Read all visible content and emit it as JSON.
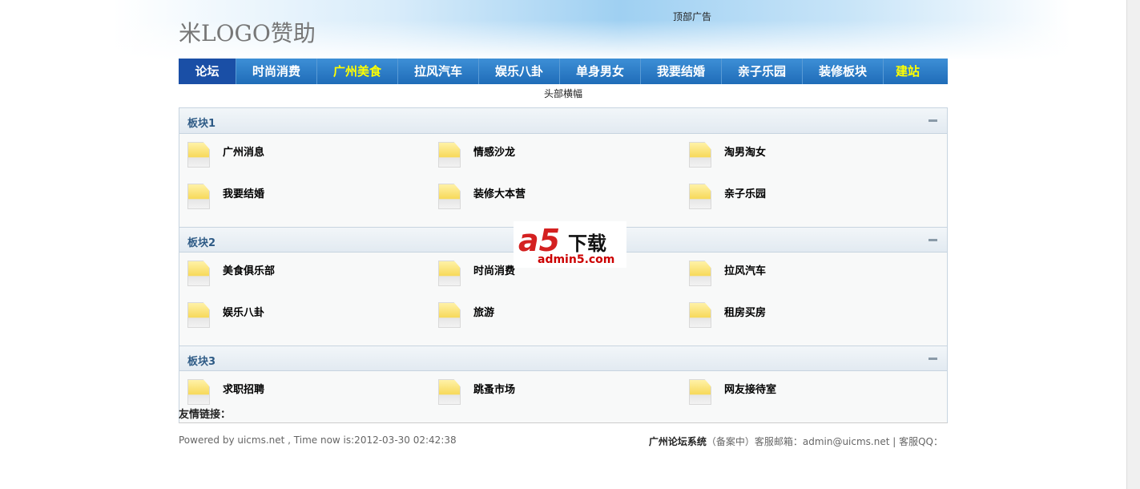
{
  "header": {
    "logo": "米LOGO赞助",
    "top_ad": "顶部广告",
    "banner": "头部横幅"
  },
  "nav": [
    {
      "label": "论坛"
    },
    {
      "label": "时尚消费"
    },
    {
      "label": "广州美食"
    },
    {
      "label": "拉风汽车"
    },
    {
      "label": "娱乐八卦"
    },
    {
      "label": "单身男女"
    },
    {
      "label": "我要结婚"
    },
    {
      "label": "亲子乐园"
    },
    {
      "label": "装修板块"
    },
    {
      "label": "建站"
    }
  ],
  "sections": [
    {
      "title": "板块1",
      "forums": [
        "广州消息",
        "情感沙龙",
        "淘男淘女",
        "我要结婚",
        "装修大本营",
        "亲子乐园"
      ]
    },
    {
      "title": "板块2",
      "forums": [
        "美食俱乐部",
        "时尚消费",
        "拉风汽车",
        "娱乐八卦",
        "旅游",
        "租房买房"
      ]
    },
    {
      "title": "板块3",
      "forums": [
        "求职招聘",
        "跳蚤市场",
        "网友接待室"
      ]
    }
  ],
  "footer": {
    "friend_links": "友情链接：",
    "powered": "Powered by uicms.net , Time now is:2012-03-30 02:42:38",
    "site_name": "广州论坛系统",
    "right": "（备案中）客服邮箱：admin@uicms.net | 客服QQ："
  },
  "watermark": {
    "brand": "a5",
    "text": "下载",
    "url": "admin5.com"
  }
}
